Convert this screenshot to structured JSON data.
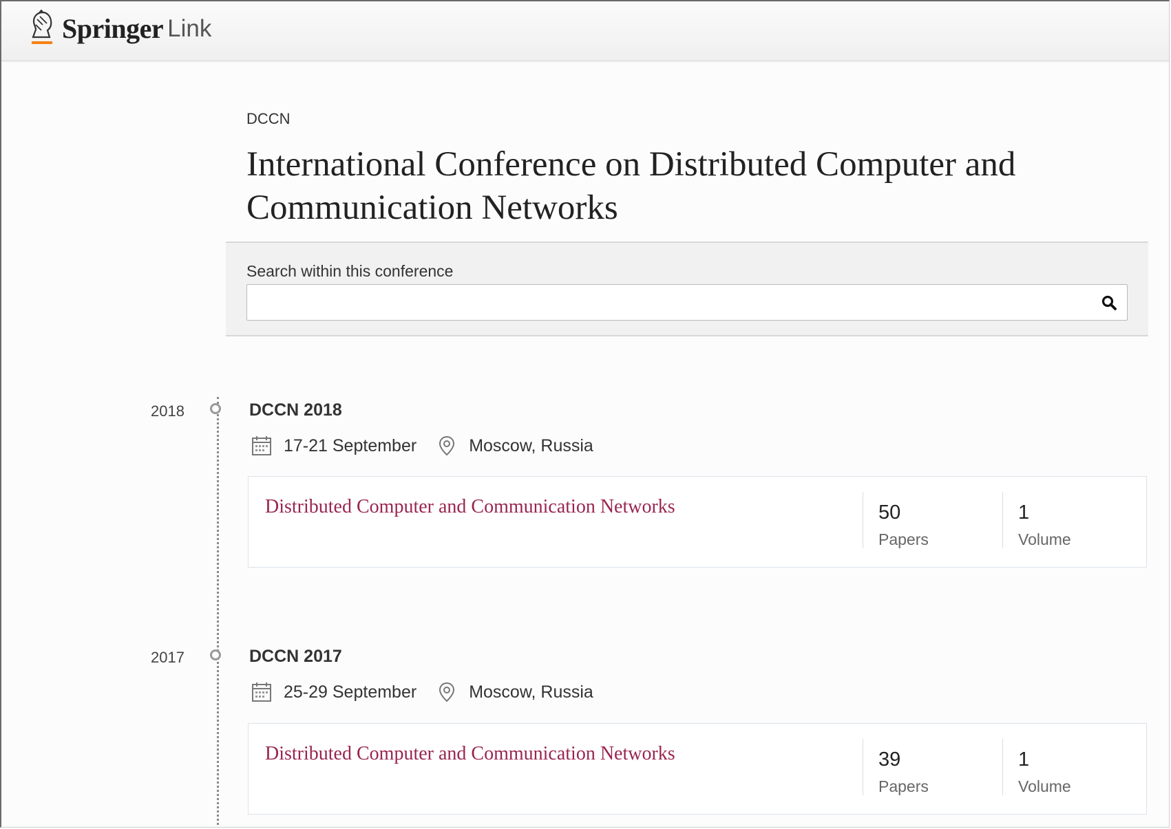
{
  "header": {
    "logo_springer": "Springer",
    "logo_link": "Link",
    "accent": "#f68212"
  },
  "conference": {
    "acronym": "DCCN",
    "title": "International Conference on Distributed Computer and Communication Networks"
  },
  "search": {
    "label": "Search within this conference",
    "value": "",
    "placeholder": "",
    "icon": "search-icon"
  },
  "editions": [
    {
      "year": "2018",
      "name": "DCCN 2018",
      "dates": "17-21 September",
      "location": "Moscow, Russia",
      "proceedings_title": "Distributed Computer and Communication Networks",
      "papers": "50",
      "papers_label": "Papers",
      "volumes": "1",
      "volumes_label": "Volume"
    },
    {
      "year": "2017",
      "name": "DCCN 2017",
      "dates": "25-29 September",
      "location": "Moscow, Russia",
      "proceedings_title": "Distributed Computer and Communication Networks",
      "papers": "39",
      "papers_label": "Papers",
      "volumes": "1",
      "volumes_label": "Volume"
    }
  ],
  "colors": {
    "link": "#99254f",
    "timeline": "#8a8a8a"
  }
}
